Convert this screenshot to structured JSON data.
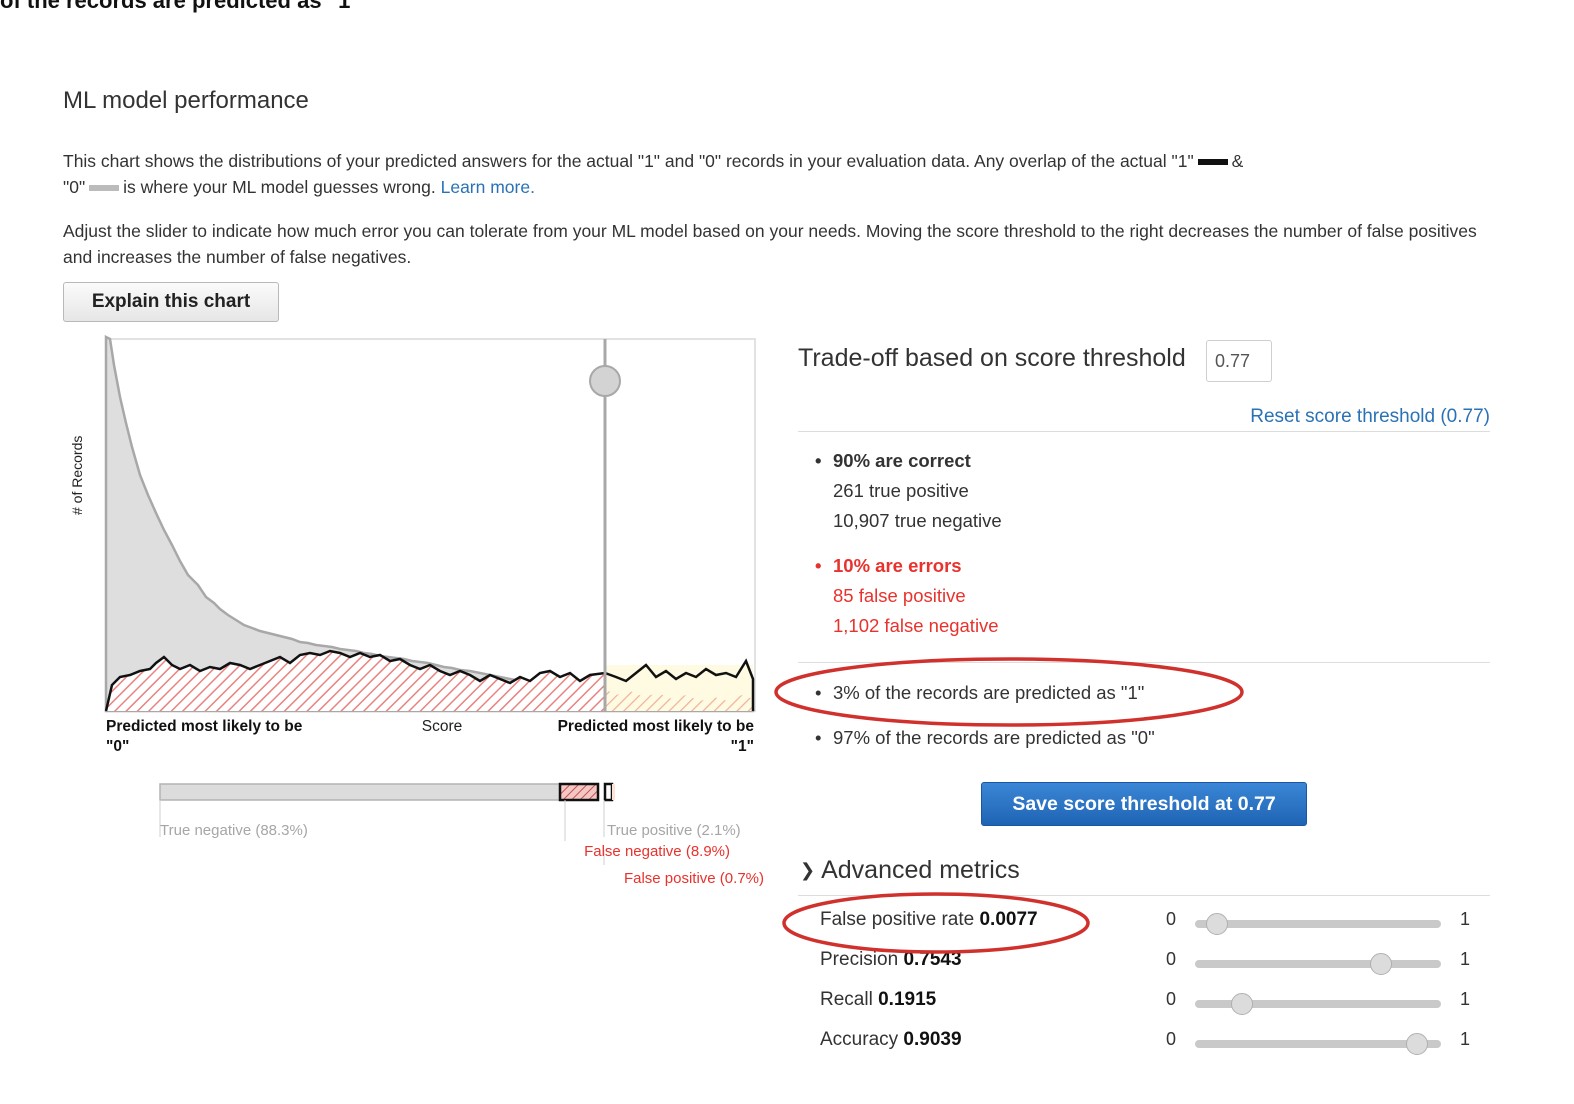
{
  "top_clip_text": "of the records are predicted as \"1\"",
  "page_title": "ML model performance",
  "description": {
    "part1": "This chart shows the distributions of your predicted answers for the actual \"1\" and \"0\" records in your evaluation data. Any overlap of the actual \"1\"",
    "amp": "&",
    "part2_prefix": "\"0\"",
    "part2": "is where your ML model guesses wrong.",
    "learn_more": "Learn more."
  },
  "adjust_text": "Adjust the slider to indicate how much error you can tolerate from your ML model based on your needs. Moving the score threshold to the right decreases the number of false positives and increases the number of false negatives.",
  "explain_button": "Explain this chart",
  "chart": {
    "y_label": "# of Records",
    "x_left_line1": "Predicted most likely to be",
    "x_left_line2": "\"0\"",
    "x_center": "Score",
    "x_right_line1": "Predicted most likely to be",
    "x_right_line2": "\"1\"",
    "threshold": 0.77
  },
  "chart_data": {
    "type": "area",
    "x_range": [
      0,
      1
    ],
    "threshold": 0.77,
    "series": [
      {
        "name": "actual \"0\"",
        "color": "#bbbbbb"
      },
      {
        "name": "actual \"1\"",
        "color": "#111111"
      }
    ]
  },
  "breakdown": {
    "true_negative": {
      "label": "True negative (88.3%)",
      "fraction": 0.883
    },
    "false_negative": {
      "label": "False negative (8.9%)",
      "fraction": 0.089
    },
    "true_positive": {
      "label": "True positive (2.1%)",
      "fraction": 0.021
    },
    "false_positive": {
      "label": "False positive (0.7%)",
      "fraction": 0.007
    }
  },
  "tradeoff": {
    "title": "Trade-off based on score threshold",
    "input_value": "0.77",
    "reset_label": "Reset score threshold (0.77)"
  },
  "correct": {
    "heading": "90% are correct",
    "line1": "261 true positive",
    "line2": "10,907 true negative"
  },
  "errors": {
    "heading": "10% are errors",
    "line1": "85 false positive",
    "line2": "1,102 false negative"
  },
  "predicted": {
    "as_one": "3% of the records are predicted as \"1\"",
    "as_zero": "97% of the records are predicted as \"0\""
  },
  "save_button": "Save score threshold at 0.77",
  "advanced": {
    "toggle_label": "Advanced metrics",
    "min_label": "0",
    "max_label": "1",
    "metrics": [
      {
        "label": "False positive rate",
        "value": "0.0077",
        "level": 0.0077
      },
      {
        "label": "Precision",
        "value": "0.7543",
        "level": 0.7543
      },
      {
        "label": "Recall",
        "value": "0.1915",
        "level": 0.1915
      },
      {
        "label": "Accuracy",
        "value": "0.9039",
        "level": 0.9039
      }
    ]
  },
  "colors": {
    "link": "#2a72b5",
    "error_red": "#e8322d",
    "annotation_red": "#d0312d",
    "save_blue": "#2a72c8"
  }
}
